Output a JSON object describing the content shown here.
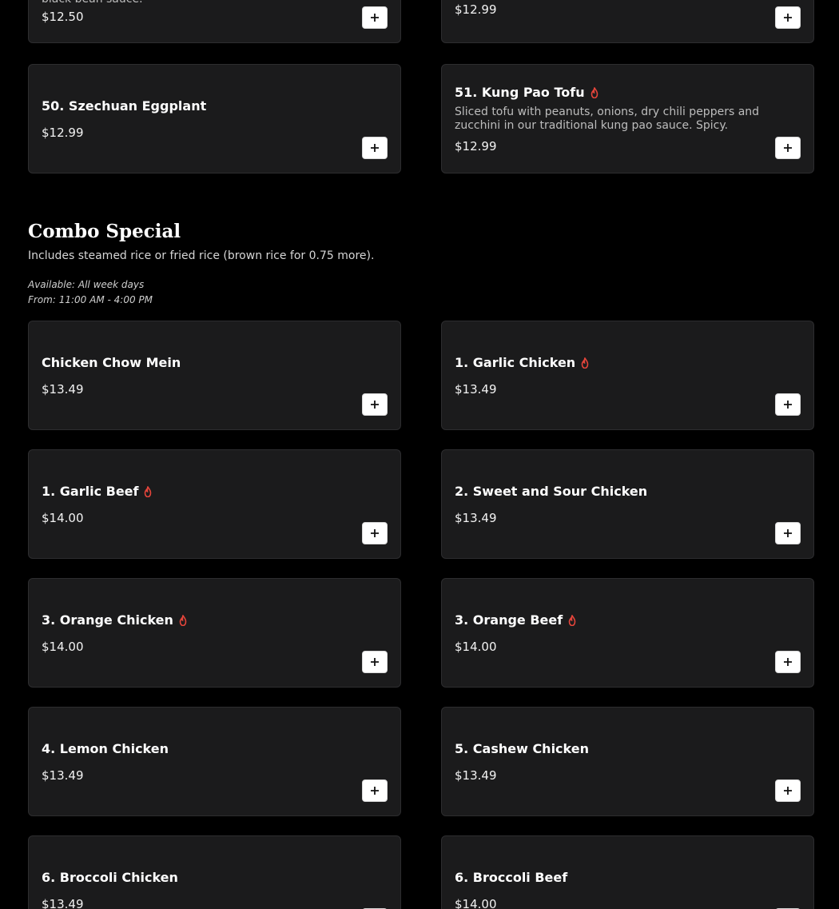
{
  "top_items": [
    {
      "description": "black bean sauce.",
      "price": "$12.50"
    },
    {
      "price": "$12.99"
    },
    {
      "name": "50. Szechuan Eggplant",
      "price": "$12.99"
    },
    {
      "name": "51. Kung Pao Tofu",
      "description": "Sliced tofu with peanuts, onions, dry chili peppers and zucchini in our traditional kung pao sauce. Spicy.",
      "price": "$12.99",
      "spicy": true
    }
  ],
  "combo": {
    "title": "Combo Special",
    "description": "Includes steamed rice or fried rice (brown rice for 0.75 more).",
    "available": "Available: All week days",
    "hours": "From: 11:00 AM - 4:00 PM",
    "items": [
      {
        "name": "Chicken Chow Mein",
        "price": "$13.49"
      },
      {
        "name": "1. Garlic Chicken",
        "price": "$13.49",
        "spicy": true
      },
      {
        "name": "1. Garlic Beef",
        "price": "$14.00",
        "spicy": true
      },
      {
        "name": "2. Sweet and Sour Chicken",
        "price": "$13.49"
      },
      {
        "name": "3. Orange Chicken",
        "price": "$14.00",
        "spicy": true
      },
      {
        "name": "3. Orange Beef",
        "price": "$14.00",
        "spicy": true
      },
      {
        "name": "4. Lemon Chicken",
        "price": "$13.49"
      },
      {
        "name": "5. Cashew Chicken",
        "price": "$13.49"
      },
      {
        "name": "6. Broccoli Chicken",
        "price": "$13.49"
      },
      {
        "name": "6. Broccoli Beef",
        "price": "$14.00"
      }
    ]
  },
  "icons": {
    "add": "plus-icon",
    "spicy": "flame-icon"
  },
  "colors": {
    "background": "#000000",
    "card": "#1b1b1c",
    "spicy": "#e5453b",
    "button": "#ffffff"
  }
}
